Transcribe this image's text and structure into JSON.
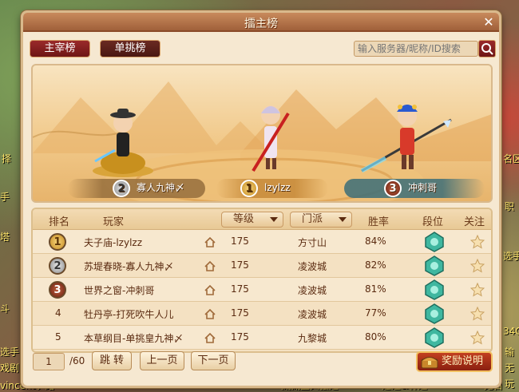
{
  "window": {
    "title": "擂主榜",
    "close": "✕"
  },
  "tabs": [
    {
      "label": "主宰榜"
    },
    {
      "label": "单挑榜"
    }
  ],
  "search": {
    "placeholder": "输入服务器/昵称/ID搜索"
  },
  "podium": [
    {
      "rank": "2",
      "name": "寡人九神〆"
    },
    {
      "rank": "1",
      "name": "lzylzz"
    },
    {
      "rank": "3",
      "name": "冲刺哥"
    }
  ],
  "table": {
    "headers": {
      "rank": "排名",
      "player": "玩家",
      "level": "等级",
      "sect": "门派",
      "winrate": "胜率",
      "tier": "段位",
      "follow": "关注"
    },
    "rows": [
      {
        "rank": "1",
        "name": "夫子庙-lzylzz",
        "level": "175",
        "sect": "方寸山",
        "winrate": "84%"
      },
      {
        "rank": "2",
        "name": "苏堤春晓-寡人九神〆",
        "level": "175",
        "sect": "凌波城",
        "winrate": "82%"
      },
      {
        "rank": "3",
        "name": "世界之窗-冲刺哥",
        "level": "175",
        "sect": "凌波城",
        "winrate": "81%"
      },
      {
        "rank": "4",
        "name": "牡丹亭-打死吹牛人儿",
        "level": "175",
        "sect": "凌波城",
        "winrate": "77%"
      },
      {
        "rank": "5",
        "name": "本草纲目-单挑皇九神〆",
        "level": "175",
        "sect": "九黎城",
        "winrate": "80%"
      }
    ]
  },
  "pagination": {
    "current": "1",
    "total": "/60",
    "jump": "跳 转",
    "prev": "上一页",
    "next": "下一页"
  },
  "reward_button": "奖励说明",
  "background_text": {
    "left": [
      "择",
      "手",
      "塔",
      "斗",
      "选手",
      "戏剧"
    ],
    "right": [
      "名区",
      "职",
      "选手",
      "34Q",
      "输",
      "无",
      "玩"
    ],
    "bottom_left": "vincent丿路",
    "bottom_mid1": "藏藏宝火强定",
    "bottom_mid2": "逍遥&轩逸",
    "bottom_right": "无目"
  },
  "colors": {
    "accent": "#8a1e1e",
    "panel": "#f6e8d1",
    "gold": "#c58a22"
  }
}
